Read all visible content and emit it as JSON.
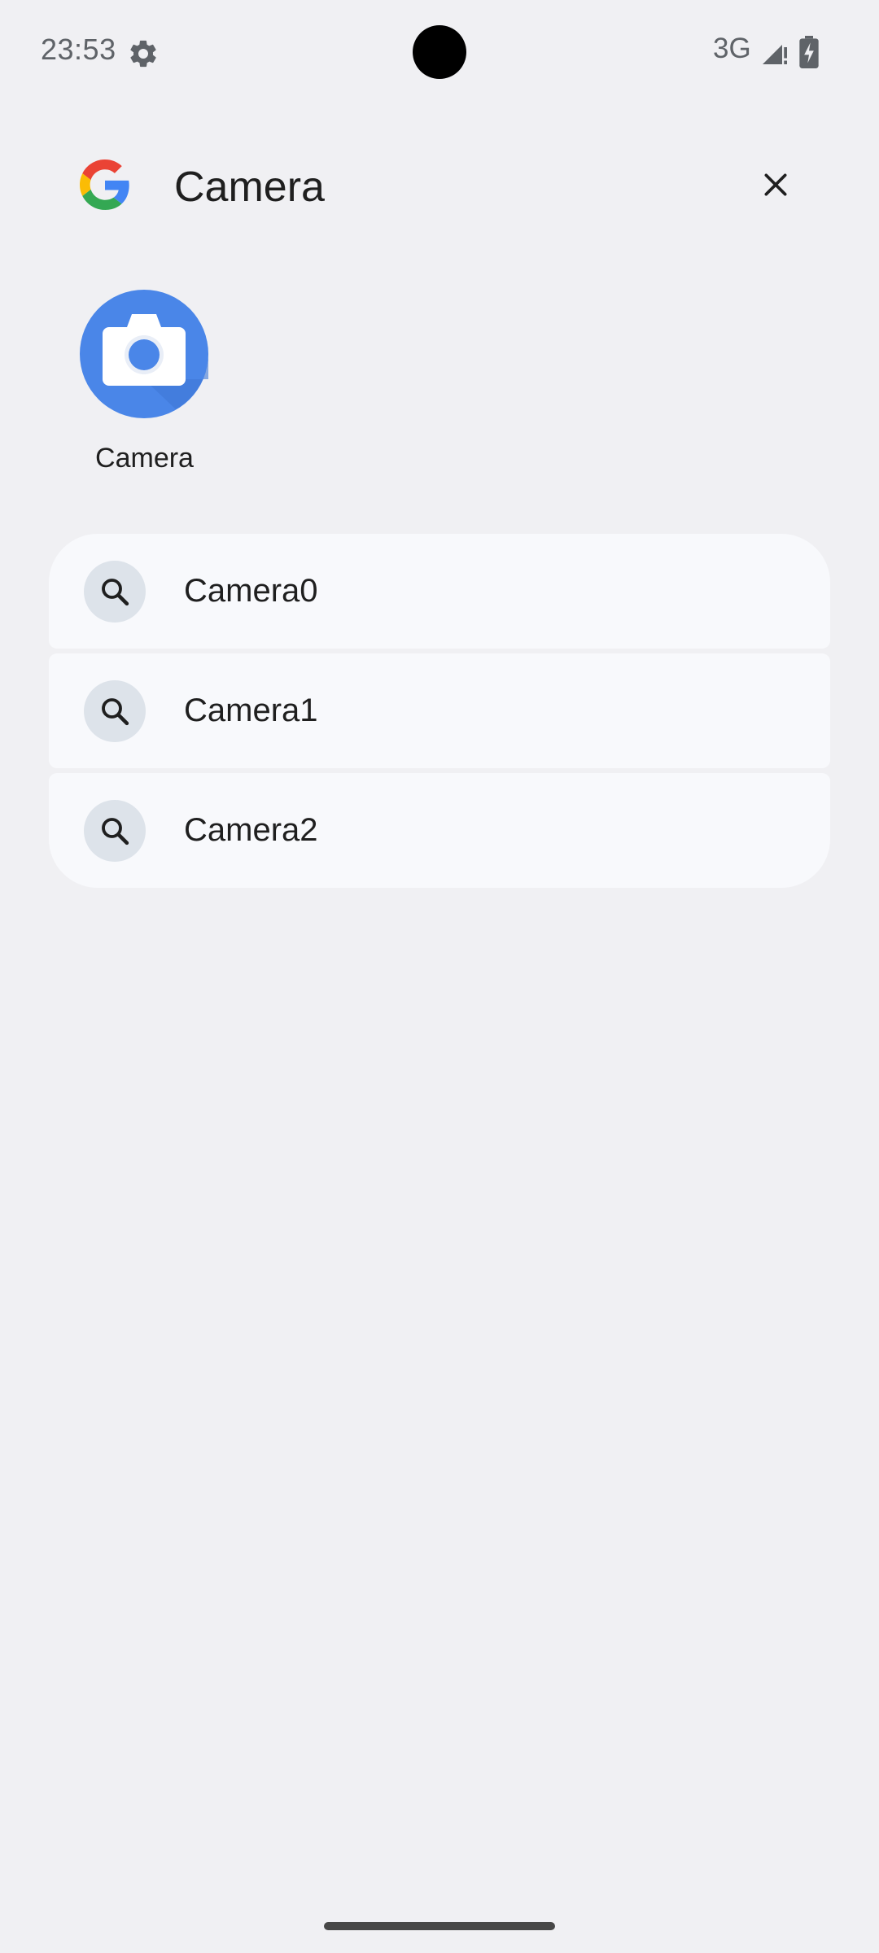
{
  "status_bar": {
    "time": "23:53",
    "network": "3G",
    "settings_icon": "gear-icon",
    "signal_icon": "cell-signal-icon",
    "battery_icon": "battery-charging-icon"
  },
  "search": {
    "query": "Camera",
    "logo_icon": "google-logo",
    "clear_icon": "close-icon"
  },
  "app_result": {
    "label": "Camera",
    "icon": "camera-app-icon"
  },
  "suggestions": [
    {
      "text": "Camera0",
      "icon": "search-icon"
    },
    {
      "text": "Camera1",
      "icon": "search-icon"
    },
    {
      "text": "Camera2",
      "icon": "search-icon"
    }
  ],
  "colors": {
    "background": "#f0f0f3",
    "card": "#f8f9fc",
    "icon_chip": "#dde3ea",
    "camera_blue": "#4a86e8"
  }
}
